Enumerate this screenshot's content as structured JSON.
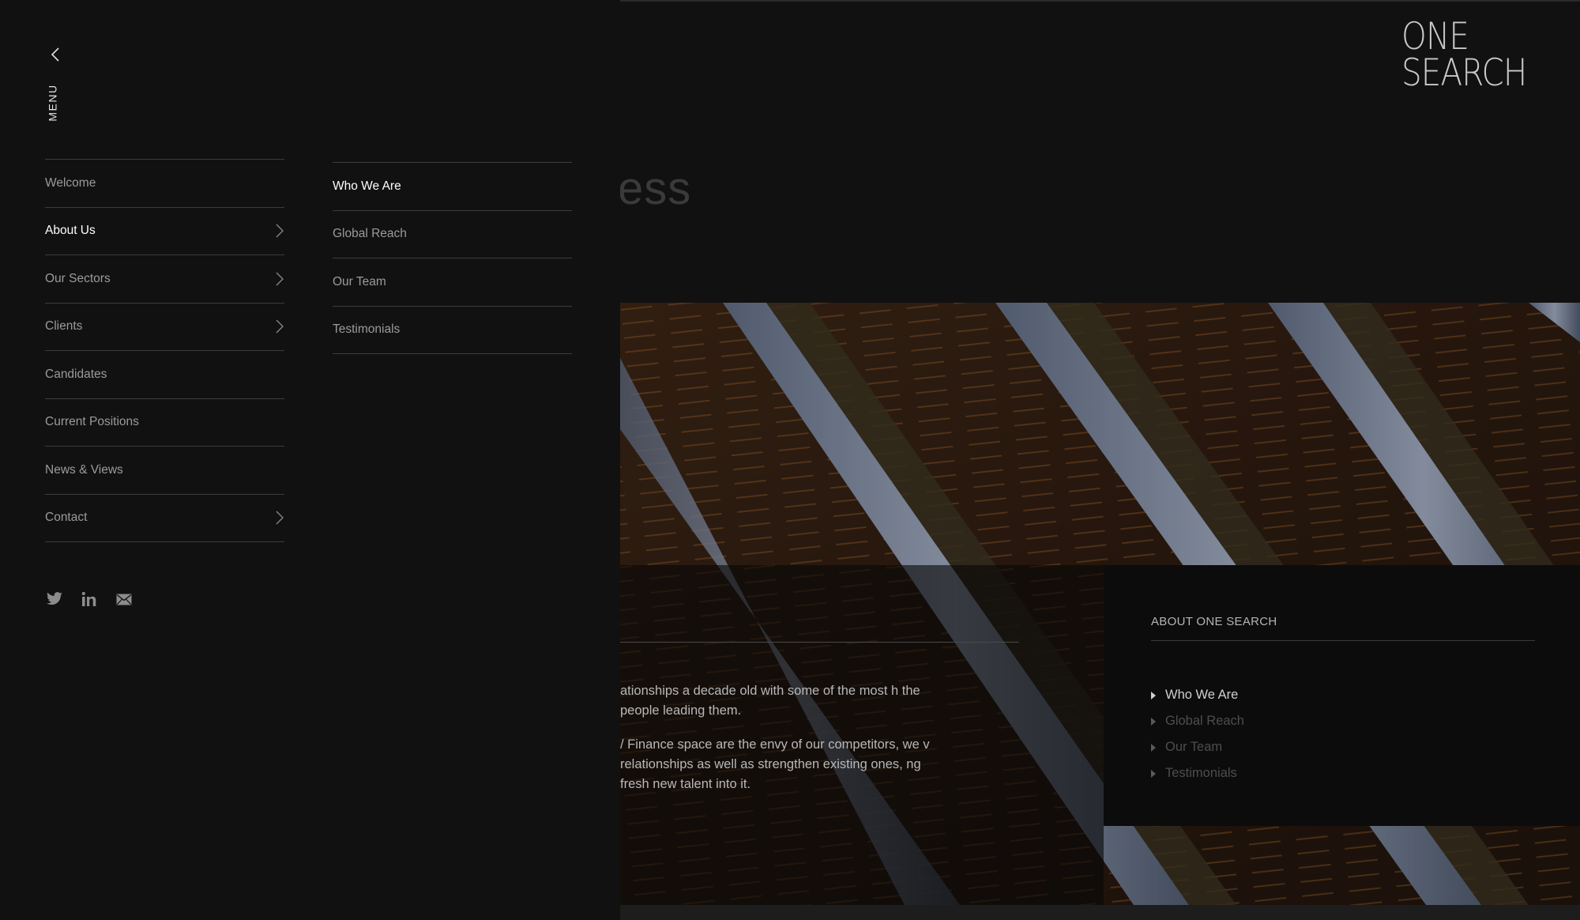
{
  "brand": {
    "line1": "ONE",
    "line2": "SEARCH"
  },
  "menu": {
    "label": "MENU",
    "back_icon": "chevron-left-icon"
  },
  "primary_nav": [
    {
      "label": "Welcome",
      "active": false,
      "has_submenu": false
    },
    {
      "label": "About Us",
      "active": true,
      "has_submenu": true
    },
    {
      "label": "Our Sectors",
      "active": false,
      "has_submenu": true
    },
    {
      "label": "Clients",
      "active": false,
      "has_submenu": true
    },
    {
      "label": "Candidates",
      "active": false,
      "has_submenu": false
    },
    {
      "label": "Current Positions",
      "active": false,
      "has_submenu": false
    },
    {
      "label": "News & Views",
      "active": false,
      "has_submenu": false
    },
    {
      "label": "Contact",
      "active": false,
      "has_submenu": true
    }
  ],
  "secondary_nav": [
    {
      "label": "Who We Are",
      "active": true
    },
    {
      "label": "Global Reach",
      "active": false
    },
    {
      "label": "Our Team",
      "active": false
    },
    {
      "label": "Testimonials",
      "active": false
    }
  ],
  "social": [
    "twitter-icon",
    "linkedin-icon",
    "email-icon"
  ],
  "background": {
    "heading_fragment": "ess",
    "paragraph1": "ationships a decade old with some of the most h the people leading them.",
    "paragraph2": "/ Finance space are the envy of our competitors, we v relationships as well as strengthen existing ones, ng fresh new talent into it."
  },
  "about_panel": {
    "title": "ABOUT ONE SEARCH",
    "items": [
      {
        "label": "Who We Are",
        "active": true
      },
      {
        "label": "Global Reach",
        "active": false
      },
      {
        "label": "Our Team",
        "active": false
      },
      {
        "label": "Testimonials",
        "active": false
      }
    ]
  },
  "colors": {
    "background": "#111111",
    "divider": "#3c3c3c",
    "text_muted": "#9b9b9b",
    "text_active": "#ffffff"
  }
}
